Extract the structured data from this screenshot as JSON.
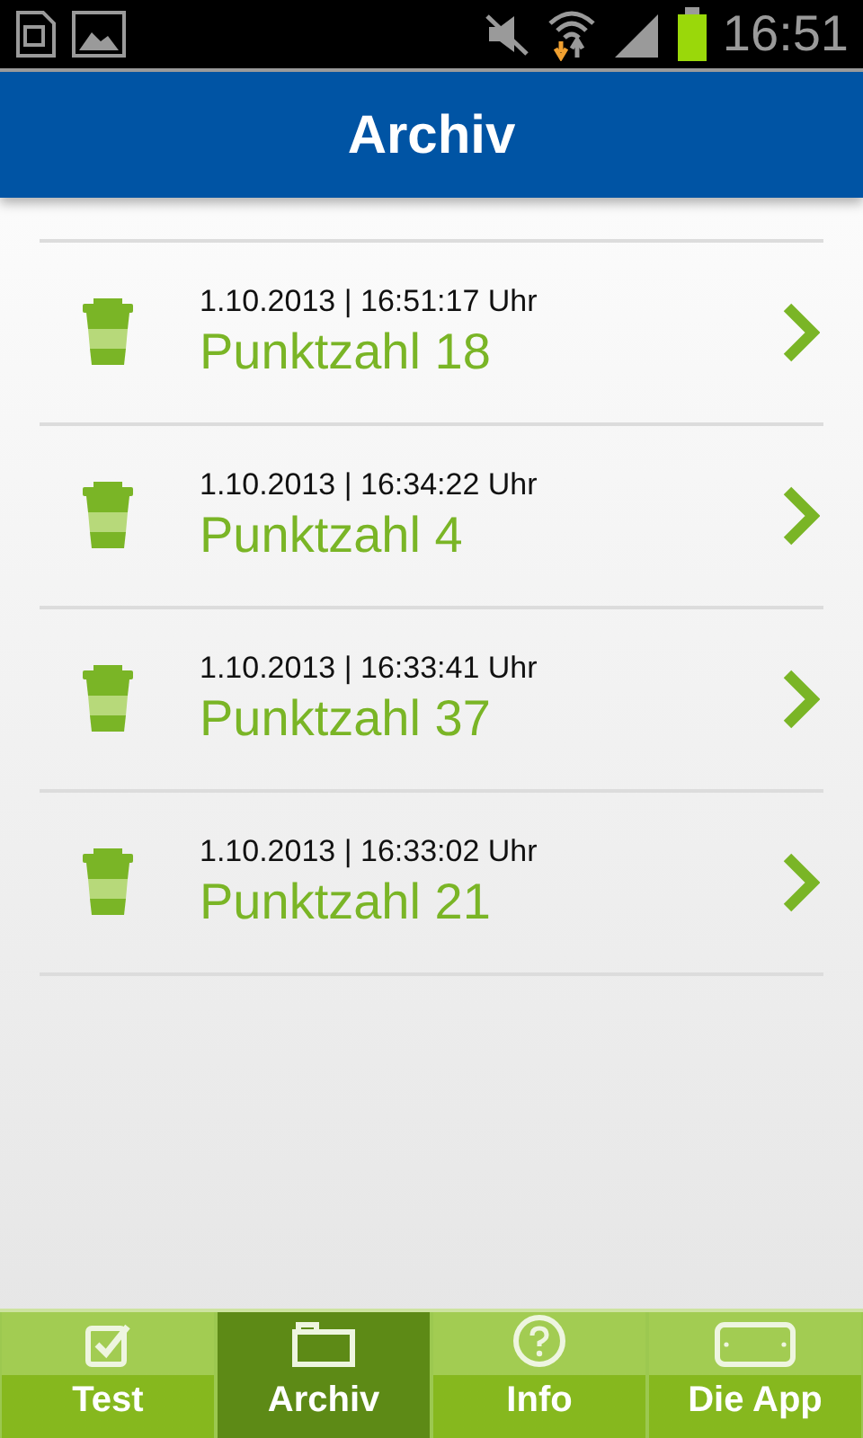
{
  "status_bar": {
    "time": "16:51"
  },
  "header": {
    "title": "Archiv"
  },
  "entries": [
    {
      "timestamp": "1.10.2013 | 16:51:17 Uhr",
      "score": "Punktzahl 18"
    },
    {
      "timestamp": "1.10.2013 | 16:34:22 Uhr",
      "score": "Punktzahl 4"
    },
    {
      "timestamp": "1.10.2013 | 16:33:41 Uhr",
      "score": "Punktzahl 37"
    },
    {
      "timestamp": "1.10.2013 | 16:33:02 Uhr",
      "score": "Punktzahl 21"
    }
  ],
  "tabs": [
    {
      "kind": "test",
      "label": "Test",
      "selected": false
    },
    {
      "kind": "archive",
      "label": "Archiv",
      "selected": true
    },
    {
      "kind": "info",
      "label": "Info",
      "selected": false
    },
    {
      "kind": "app",
      "label": "Die App",
      "selected": false
    }
  ]
}
